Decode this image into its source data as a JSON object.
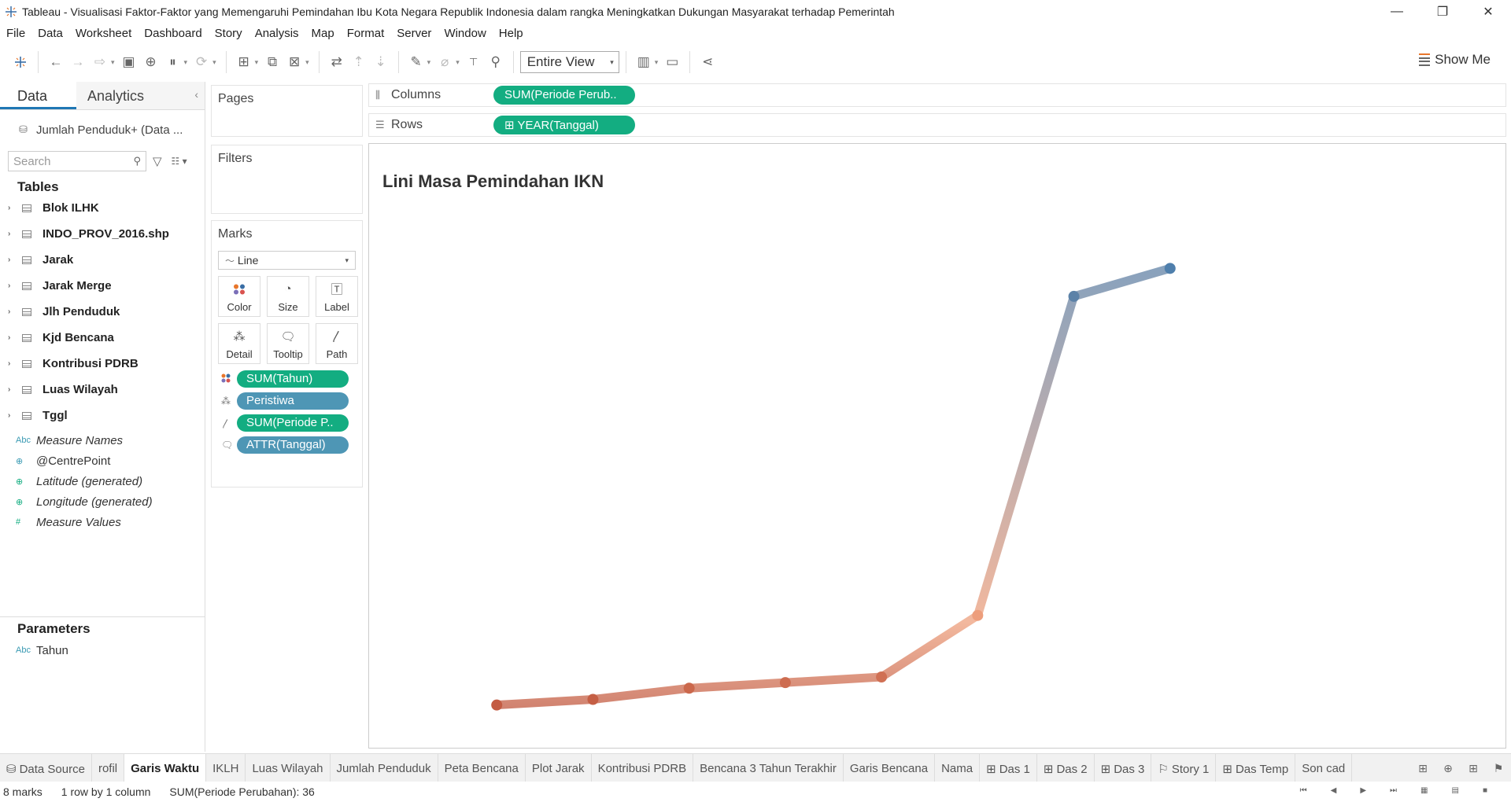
{
  "window": {
    "title": "Tableau - Visualisasi Faktor-Faktor yang Memengaruhi Pemindahan Ibu Kota Negara Republik Indonesia dalam rangka Meningkatkan Dukungan Masyarakat terhadap Pemerintah",
    "minimize": "—",
    "restore": "❐",
    "close": "✕"
  },
  "menu": [
    "File",
    "Data",
    "Worksheet",
    "Dashboard",
    "Story",
    "Analysis",
    "Map",
    "Format",
    "Server",
    "Window",
    "Help"
  ],
  "toolbar": {
    "fit_value": "Entire View",
    "show_me": "Show Me"
  },
  "data_pane": {
    "tab_data": "Data",
    "tab_analytics": "Analytics",
    "datasource": "Jumlah Penduduk+ (Data ...",
    "search_placeholder": "Search",
    "tables_heading": "Tables",
    "tables": [
      "Blok ILHK",
      "INDO_PROV_2016.shp",
      "Jarak",
      "Jarak Merge",
      "Jlh Penduduk",
      "Kjd Bencana",
      "Kontribusi PDRB",
      "Luas Wilayah",
      "Tggl"
    ],
    "fields": [
      {
        "icon": "Abc",
        "label": "Measure Names",
        "italic": true
      },
      {
        "icon": "⊕",
        "label": "@CentrePoint",
        "italic": false
      },
      {
        "icon": "⊕",
        "label": "Latitude (generated)",
        "italic": true
      },
      {
        "icon": "⊕",
        "label": "Longitude (generated)",
        "italic": true
      },
      {
        "icon": "#",
        "label": "Measure Values",
        "italic": true
      }
    ],
    "parameters_heading": "Parameters",
    "parameters": [
      {
        "icon": "Abc",
        "label": "Tahun"
      }
    ]
  },
  "shelves": {
    "pages": "Pages",
    "filters": "Filters",
    "marks": "Marks",
    "mark_type": "Line",
    "mark_buttons": [
      {
        "label": "Color",
        "icon": "color-icon"
      },
      {
        "label": "Size",
        "icon": "size-icon"
      },
      {
        "label": "Label",
        "icon": "label-icon"
      },
      {
        "label": "Detail",
        "icon": "detail-icon"
      },
      {
        "label": "Tooltip",
        "icon": "tooltip-icon"
      },
      {
        "label": "Path",
        "icon": "path-icon"
      }
    ],
    "mark_pills": [
      {
        "label": "SUM(Tahun)",
        "color": "green",
        "icon": "color-icon"
      },
      {
        "label": "Peristiwa",
        "color": "blue",
        "icon": "detail-icon"
      },
      {
        "label": "SUM(Periode P..",
        "color": "green",
        "icon": "path-icon"
      },
      {
        "label": "ATTR(Tanggal)",
        "color": "blue",
        "icon": "tooltip-icon"
      }
    ],
    "columns_label": "Columns",
    "columns_pill": "SUM(Periode Perub..",
    "rows_label": "Rows",
    "rows_pill": "⊞ YEAR(Tanggal)"
  },
  "view": {
    "title": "Lini Masa Pemindahan IKN"
  },
  "chart_data": {
    "type": "line",
    "title": "Lini Masa Pemindahan IKN",
    "xlabel": "",
    "ylabel": "",
    "grid": false,
    "points": [
      {
        "x": 1,
        "y": 1
      },
      {
        "x": 2,
        "y": 2
      },
      {
        "x": 3,
        "y": 4
      },
      {
        "x": 4,
        "y": 5
      },
      {
        "x": 5,
        "y": 6
      },
      {
        "x": 6,
        "y": 17
      },
      {
        "x": 7,
        "y": 74
      },
      {
        "x": 8,
        "y": 79
      }
    ],
    "color_start": "#c0573e",
    "color_mid": "#eea07d",
    "color_end": "#4f7fac",
    "xlim": [
      0,
      9
    ],
    "ylim": [
      -2,
      90
    ]
  },
  "sheet_tabs": [
    {
      "label": "Data Source",
      "icon": "⛁",
      "active": false
    },
    {
      "label": "rofil",
      "icon": "",
      "active": false
    },
    {
      "label": "Garis Waktu",
      "icon": "",
      "active": true
    },
    {
      "label": "IKLH",
      "icon": "",
      "active": false
    },
    {
      "label": "Luas Wilayah",
      "icon": "",
      "active": false
    },
    {
      "label": "Jumlah Penduduk",
      "icon": "",
      "active": false
    },
    {
      "label": "Peta Bencana",
      "icon": "",
      "active": false
    },
    {
      "label": "Plot Jarak",
      "icon": "",
      "active": false
    },
    {
      "label": "Kontribusi PDRB",
      "icon": "",
      "active": false
    },
    {
      "label": "Bencana 3 Tahun Terakhir",
      "icon": "",
      "active": false
    },
    {
      "label": "Garis Bencana",
      "icon": "",
      "active": false
    },
    {
      "label": "Nama",
      "icon": "",
      "active": false
    },
    {
      "label": "Das 1",
      "icon": "⊞",
      "active": false
    },
    {
      "label": "Das 2",
      "icon": "⊞",
      "active": false
    },
    {
      "label": "Das 3",
      "icon": "⊞",
      "active": false
    },
    {
      "label": "Story 1",
      "icon": "⚐",
      "active": false
    },
    {
      "label": "Das Temp",
      "icon": "⊞",
      "active": false
    },
    {
      "label": "Son cad",
      "icon": "",
      "active": false
    }
  ],
  "status": {
    "marks": "8 marks",
    "layout": "1 row by 1 column",
    "sum": "SUM(Periode Perubahan): 36"
  }
}
